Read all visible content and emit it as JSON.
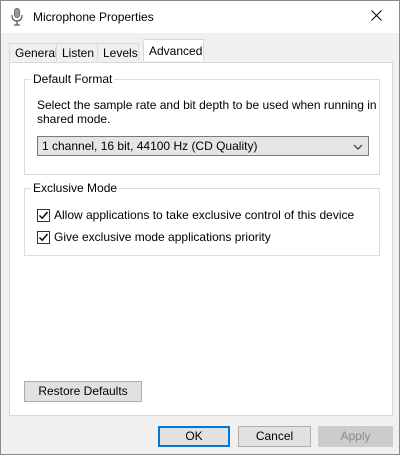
{
  "window": {
    "title": "Microphone Properties",
    "icon": "microphone-icon",
    "close_icon": "close-icon"
  },
  "tabs": [
    {
      "label": "General"
    },
    {
      "label": "Listen"
    },
    {
      "label": "Levels"
    },
    {
      "label": "Advanced",
      "selected": true
    }
  ],
  "default_format": {
    "group_label": "Default Format",
    "description": "Select the sample rate and bit depth to be used when running in shared mode.",
    "selected_value": "1 channel, 16 bit, 44100 Hz (CD Quality)"
  },
  "exclusive_mode": {
    "group_label": "Exclusive Mode",
    "options": [
      {
        "label": "Allow applications to take exclusive control of this device",
        "checked": true
      },
      {
        "label": "Give exclusive mode applications priority",
        "checked": true
      }
    ]
  },
  "buttons": {
    "restore_defaults": "Restore Defaults",
    "ok": "OK",
    "cancel": "Cancel",
    "apply": "Apply"
  },
  "colors": {
    "focus_border": "#0078d7",
    "dialog_bg": "#f0f0f0"
  }
}
